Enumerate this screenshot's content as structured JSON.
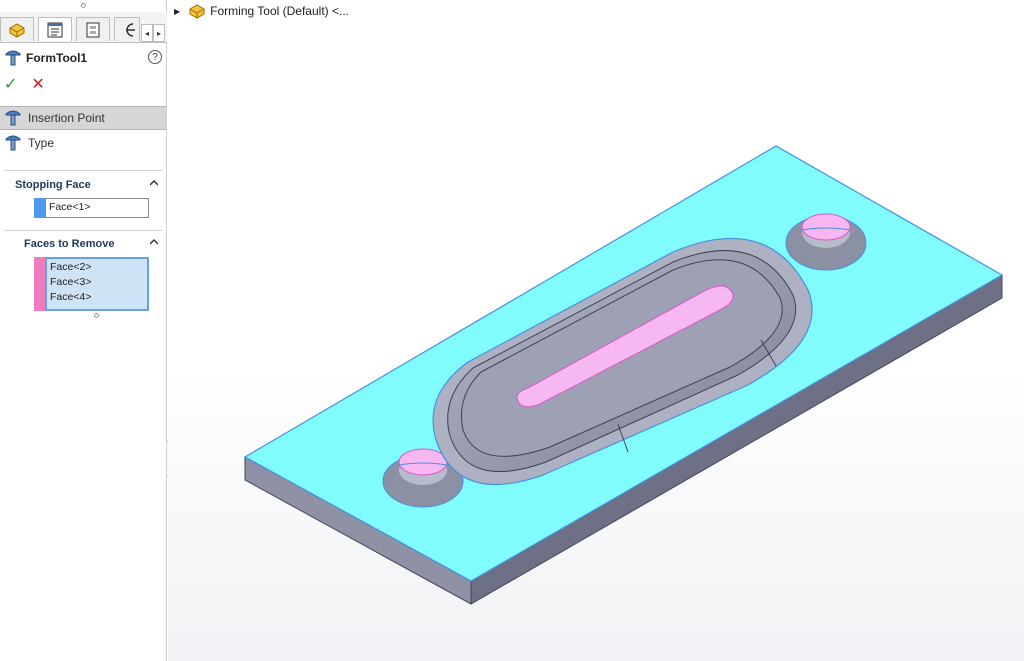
{
  "panel": {
    "feature_title": "FormTool1",
    "help_symbol": "?",
    "ok_symbol": "✓",
    "cancel_symbol": "✕",
    "steps": [
      {
        "label": "Insertion Point",
        "selected": true
      },
      {
        "label": "Type",
        "selected": false
      }
    ],
    "stopping_face": {
      "header": "Stopping Face",
      "items": [
        "Face<1>"
      ],
      "color": "#4d9bea"
    },
    "faces_to_remove": {
      "header": "Faces to Remove",
      "items": [
        "Face<2>",
        "Face<3>",
        "Face<4>"
      ],
      "color": "#f07cc0"
    },
    "scroll_left": "◂",
    "scroll_right": "▸"
  },
  "tree": {
    "expand_symbol": "▶",
    "label": "Forming Tool (Default) <..."
  },
  "colors": {
    "stopping_face": "#80fcff",
    "faces_to_remove": "#f7b8f2",
    "model_body": "#9a9db0",
    "edge_highlight": "#4a8fe0"
  },
  "icons": {
    "tab1": "feature-manager-icon",
    "tab2": "property-manager-icon",
    "tab3": "configuration-manager-icon",
    "tab4": "dimxpert-icon",
    "feature": "form-tool-icon",
    "tree": "part-icon"
  }
}
